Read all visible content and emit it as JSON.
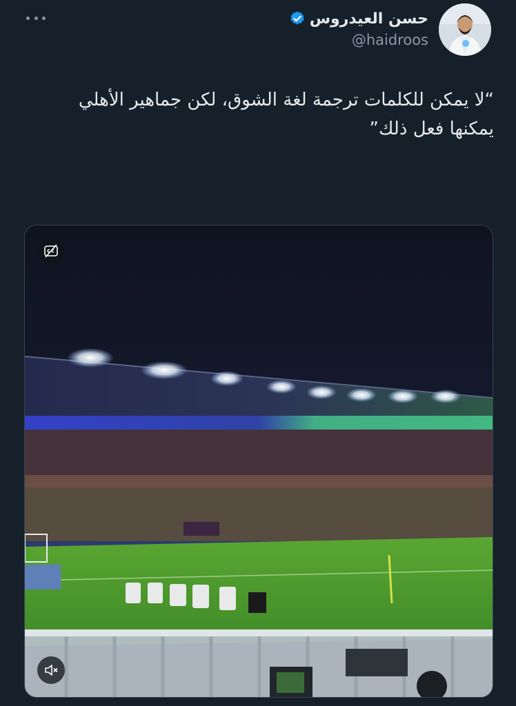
{
  "author": {
    "name": "حسن العيدروس",
    "handle": "@haidroos",
    "verified": true,
    "avatar_icon": "profile-photo"
  },
  "header": {
    "more_icon": "more-horizontal-icon"
  },
  "tweet": {
    "text": "“لا يمكن للكلمات ترجمة لغة الشوق، لكن جماهير الأهلي يمكنها فعل ذلك”"
  },
  "media": {
    "type": "video",
    "subject": "football stadium at night",
    "captions_icon": "captions-off-icon",
    "mute_icon": "speaker-muted-icon"
  },
  "colors": {
    "background": "#15202b",
    "text": "#e7e9ea",
    "secondary_text": "#8b98a5",
    "verified_badge": "#1d9bf0",
    "pitch": "#4e9f2e",
    "stand_glow_green": "#4be09a",
    "stand_glow_blue": "#3a4bff"
  }
}
